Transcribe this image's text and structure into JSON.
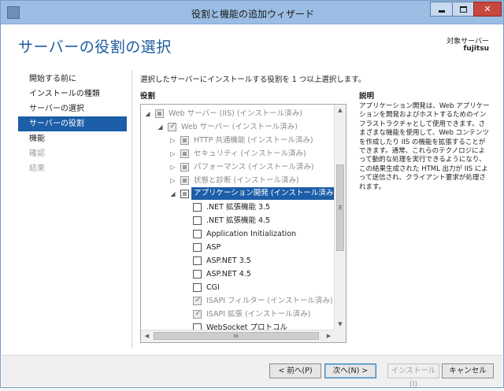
{
  "window": {
    "title": "役割と機能の追加ウィザード"
  },
  "header": {
    "title": "サーバーの役割の選択",
    "target_label": "対象サーバー",
    "target_name": "fujitsu"
  },
  "nav": {
    "items": [
      {
        "label": "開始する前に",
        "state": "normal"
      },
      {
        "label": "インストールの種類",
        "state": "normal"
      },
      {
        "label": "サーバーの選択",
        "state": "normal"
      },
      {
        "label": "サーバーの役割",
        "state": "active"
      },
      {
        "label": "機能",
        "state": "normal"
      },
      {
        "label": "確認",
        "state": "disabled"
      },
      {
        "label": "結果",
        "state": "disabled"
      }
    ]
  },
  "content": {
    "instruction": "選択したサーバーにインストールする役割を 1 つ以上選択します。",
    "roles_heading": "役割",
    "description_heading": "説明",
    "description_text": "アプリケーション開発は、Web アプリケーションを開発およびホストするためのインフラストラクチャとして使用できます。さまざまな機能を使用して、Web コンテンツを作成したり IIS の機能を拡張することができます。通常、これらのテクノロジによって動的な処理を実行できるようになり、この結果生成された HTML 出力が IIS によって送信され、クライアント要求が処理されます。"
  },
  "tree": {
    "rows": [
      {
        "label": "Web サーバー (IIS) (インストール済み)",
        "level": 0,
        "expander": "expanded",
        "check": "partial",
        "dim": true
      },
      {
        "label": "Web サーバー (インストール済み)",
        "level": 1,
        "expander": "expanded",
        "check": "checked",
        "dim": true
      },
      {
        "label": "HTTP 共通機能 (インストール済み)",
        "level": 2,
        "expander": "collapsed",
        "check": "partial",
        "dim": true
      },
      {
        "label": "セキュリティ (インストール済み)",
        "level": 2,
        "expander": "collapsed",
        "check": "partial",
        "dim": true
      },
      {
        "label": "パフォーマンス (インストール済み)",
        "level": 2,
        "expander": "collapsed",
        "check": "partial",
        "dim": true
      },
      {
        "label": "状態と診断 (インストール済み)",
        "level": 2,
        "expander": "collapsed",
        "check": "partial",
        "dim": true
      },
      {
        "label": "アプリケーション開発 (インストール済み)",
        "level": 2,
        "expander": "expanded",
        "check": "partial",
        "dim": false,
        "selected": true
      },
      {
        "label": ".NET 拡張機能 3.5",
        "level": 3,
        "expander": "none",
        "check": "unchecked",
        "dim": false
      },
      {
        "label": ".NET 拡張機能 4.5",
        "level": 3,
        "expander": "none",
        "check": "unchecked",
        "dim": false
      },
      {
        "label": "Application Initialization",
        "level": 3,
        "expander": "none",
        "check": "unchecked",
        "dim": false
      },
      {
        "label": "ASP",
        "level": 3,
        "expander": "none",
        "check": "unchecked",
        "dim": false
      },
      {
        "label": "ASP.NET 3.5",
        "level": 3,
        "expander": "none",
        "check": "unchecked",
        "dim": false
      },
      {
        "label": "ASP.NET 4.5",
        "level": 3,
        "expander": "none",
        "check": "unchecked",
        "dim": false
      },
      {
        "label": "CGI",
        "level": 3,
        "expander": "none",
        "check": "unchecked",
        "dim": false
      },
      {
        "label": "ISAPI フィルター (インストール済み)",
        "level": 3,
        "expander": "none",
        "check": "checked",
        "dim": true
      },
      {
        "label": "ISAPI 拡張 (インストール済み)",
        "level": 3,
        "expander": "none",
        "check": "checked",
        "dim": true
      },
      {
        "label": "WebSocket プロトコル",
        "level": 3,
        "expander": "none",
        "check": "unchecked",
        "dim": false
      }
    ]
  },
  "footer": {
    "back_label": "< 前へ(P)",
    "next_label": "次へ(N) >",
    "install_label": "インストール(I)",
    "cancel_label": "キャンセル"
  },
  "colors": {
    "accent": "#1c5ea8",
    "title_blue": "#1e5c9f",
    "close_red": "#c7463d"
  }
}
